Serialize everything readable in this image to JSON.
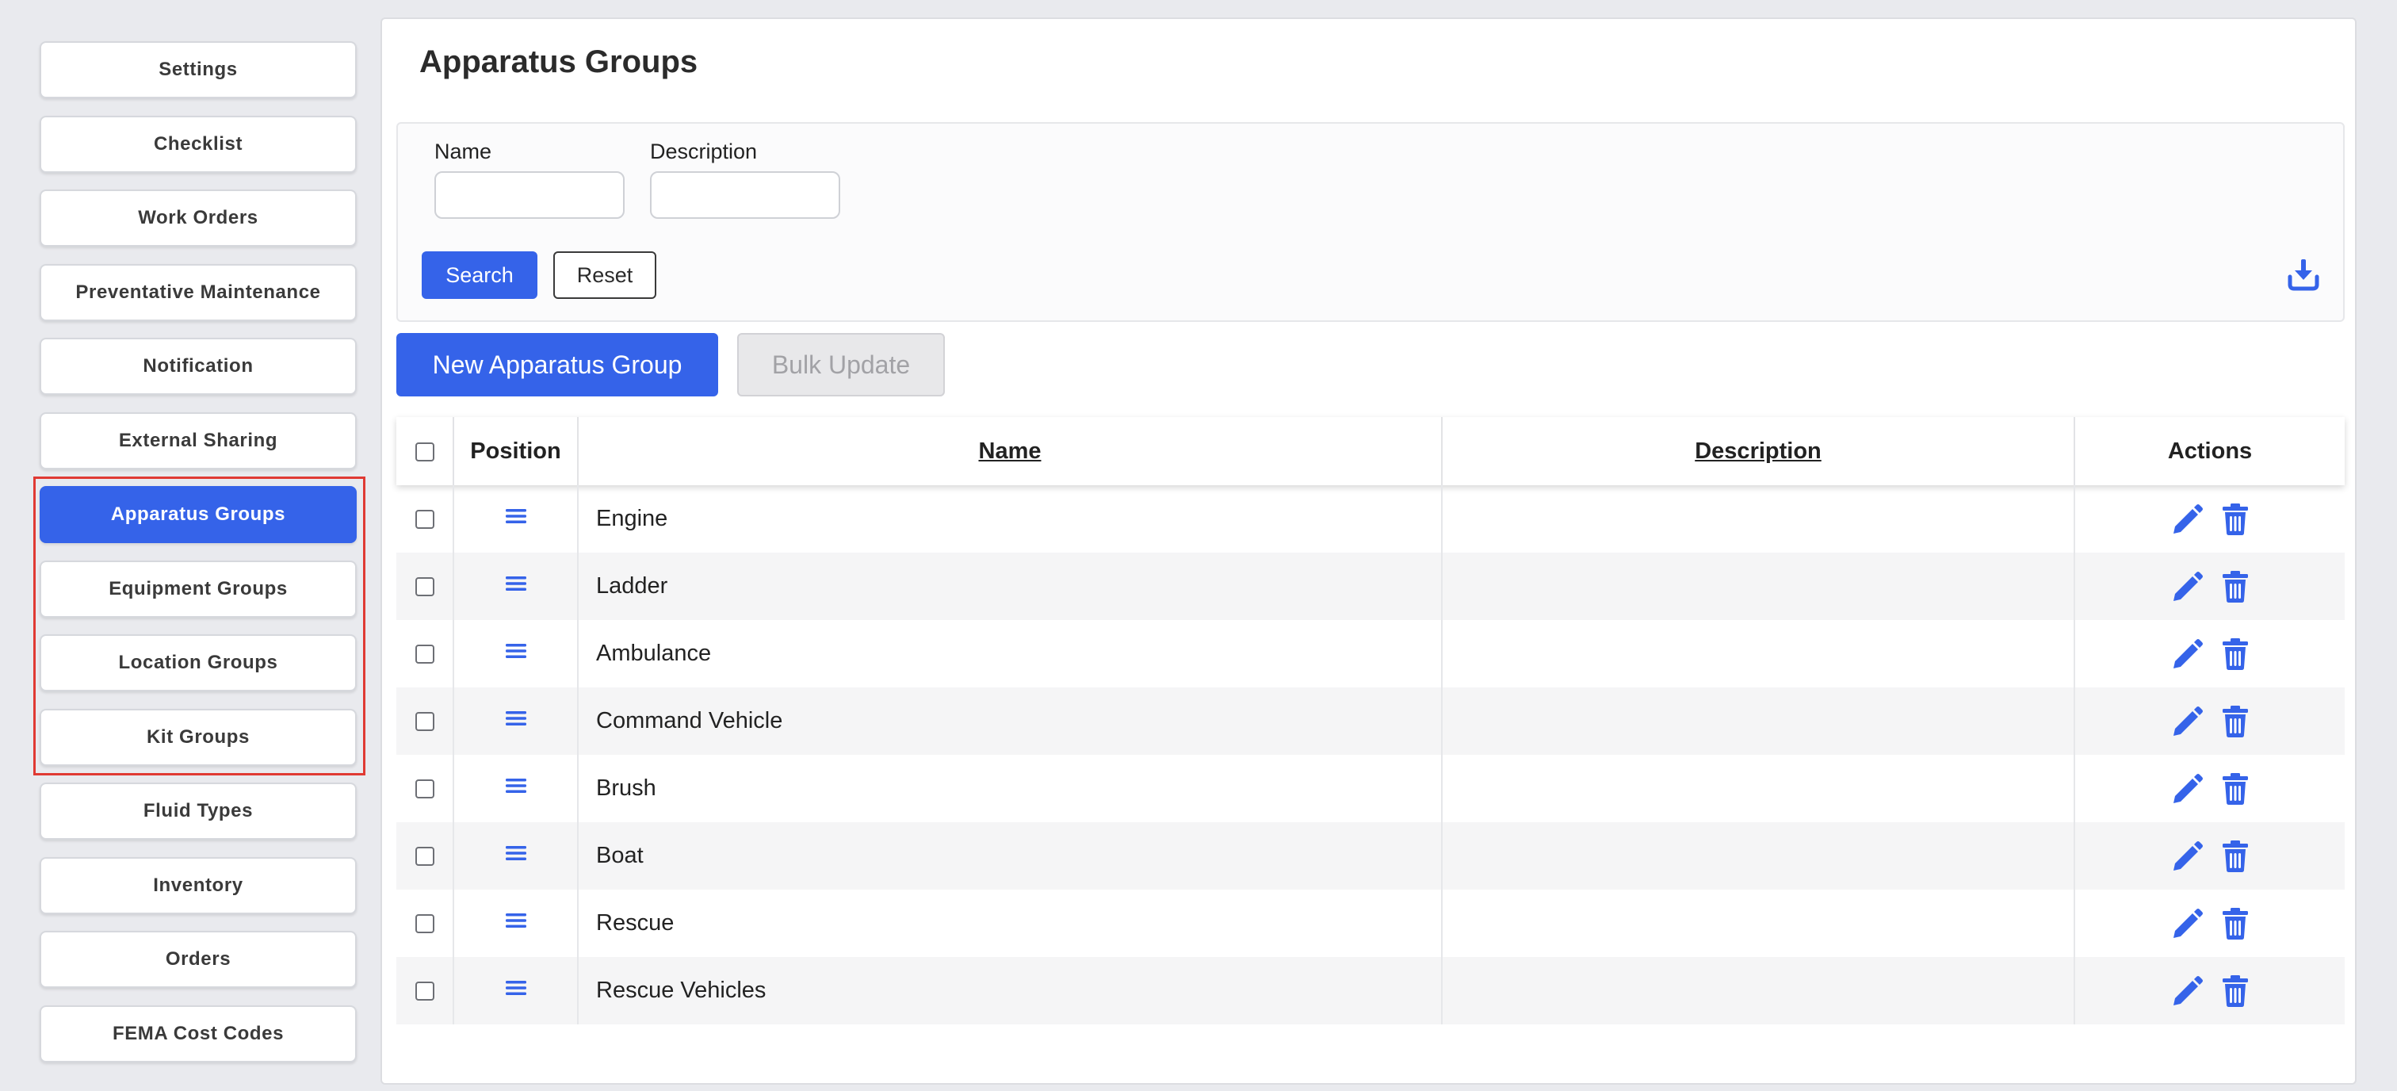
{
  "sidebar": {
    "items": [
      {
        "label": "Settings"
      },
      {
        "label": "Checklist"
      },
      {
        "label": "Work Orders"
      },
      {
        "label": "Preventative Maintenance"
      },
      {
        "label": "Notification"
      },
      {
        "label": "External Sharing"
      },
      {
        "label": "Apparatus Groups"
      },
      {
        "label": "Equipment Groups"
      },
      {
        "label": "Location Groups"
      },
      {
        "label": "Kit Groups"
      },
      {
        "label": "Fluid Types"
      },
      {
        "label": "Inventory"
      },
      {
        "label": "Orders"
      },
      {
        "label": "FEMA Cost Codes"
      }
    ],
    "active_index": 6
  },
  "page": {
    "title": "Apparatus Groups"
  },
  "filters": {
    "name_label": "Name",
    "name_value": "",
    "description_label": "Description",
    "description_value": "",
    "search_label": "Search",
    "reset_label": "Reset"
  },
  "toolbar": {
    "new_label": "New Apparatus Group",
    "bulk_label": "Bulk Update"
  },
  "table": {
    "columns": [
      "Position",
      "Name",
      "Description",
      "Actions"
    ],
    "rows": [
      {
        "name": "Engine",
        "description": ""
      },
      {
        "name": "Ladder",
        "description": ""
      },
      {
        "name": "Ambulance",
        "description": ""
      },
      {
        "name": "Command Vehicle",
        "description": ""
      },
      {
        "name": "Brush",
        "description": ""
      },
      {
        "name": "Boat",
        "description": ""
      },
      {
        "name": "Rescue",
        "description": ""
      },
      {
        "name": "Rescue Vehicles",
        "description": ""
      }
    ]
  },
  "icons": {
    "download": "download-icon",
    "drag": "drag-handle-icon",
    "edit": "pencil-icon",
    "delete": "trash-icon"
  },
  "colors": {
    "accent": "#3563e9",
    "highlight_border": "#e03a33"
  }
}
